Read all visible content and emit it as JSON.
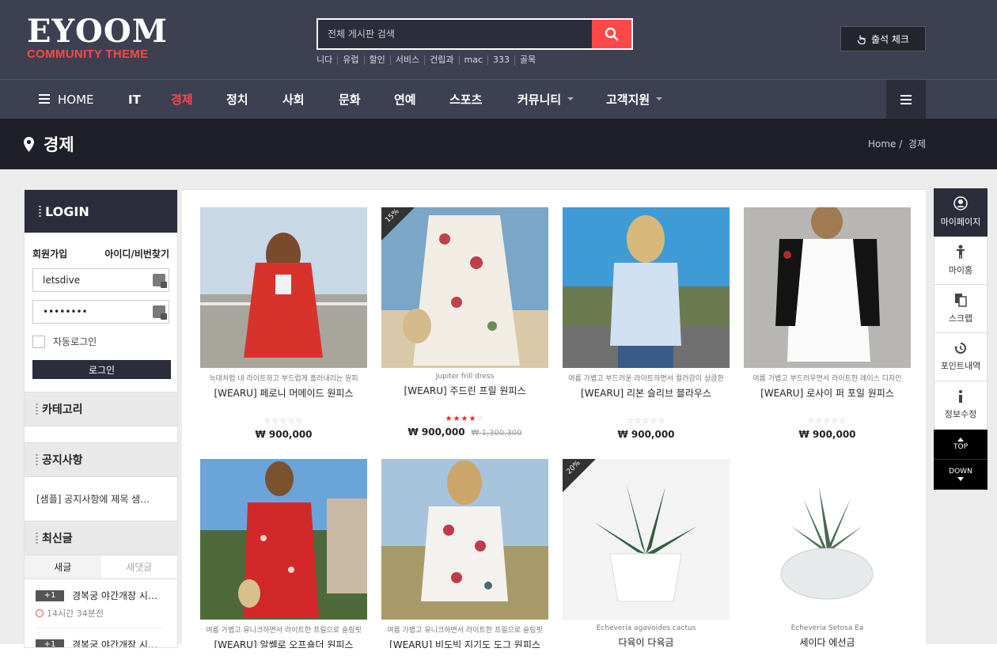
{
  "logo": {
    "main": "EYOOM",
    "sub": "COMMUNITY THEME"
  },
  "search": {
    "placeholder": "전체 게시판 검색"
  },
  "keywords": [
    "니다",
    "유럽",
    "할인",
    "서비스",
    "건립과",
    "mac",
    "333",
    "골목"
  ],
  "attend_label": "출석 체크",
  "nav": [
    {
      "label": "HOME"
    },
    {
      "label": "IT"
    },
    {
      "label": "경제"
    },
    {
      "label": "정치"
    },
    {
      "label": "사회"
    },
    {
      "label": "문화"
    },
    {
      "label": "연예"
    },
    {
      "label": "스포츠"
    },
    {
      "label": "커뮤니티"
    },
    {
      "label": "고객지원"
    }
  ],
  "page": {
    "title": "경제",
    "breadcrumb_home": "Home",
    "breadcrumb_current": "경제"
  },
  "sidebar": {
    "login_title": "LOGIN",
    "join": "회원가입",
    "find": "아이디/비번찾기",
    "username": "letsdive",
    "password": "••••••••",
    "auto_login": "자동로그인",
    "login_btn": "로그인",
    "category_title": "카테고리",
    "notice_title": "공지사항",
    "notice_item": "[샘플] 공지사항에 제목 샘…",
    "latest_title": "최신글",
    "tab_new_post": "새글",
    "tab_new_comment": "새댓글",
    "latest": [
      {
        "badge": "+1",
        "title": "경복궁 야간개장 시…",
        "time": "14시간 34분전"
      },
      {
        "badge": "+1",
        "title": "경복궁 야간개장 시…",
        "time": ""
      }
    ]
  },
  "products": [
    {
      "desc": "늑대처럼 내 라이트하고 부드럽게 흘러내리는 원피",
      "name": "[WEARU] 페로니 머메이드 원피스",
      "price": "₩ 900,000",
      "old_price": "",
      "rating": 0,
      "sale": "",
      "img": "p1"
    },
    {
      "desc": "Jupiter frill dress",
      "name": "[WEARU] 주드린 프릴 원피스",
      "price": "₩ 900,000",
      "old_price": "₩ 1,300,300",
      "rating": 4,
      "sale": "15%",
      "img": "p2"
    },
    {
      "desc": "여름 가볍고 부드러운 라이트하면서 컬러감이 상큼한",
      "name": "[WEARU] 리본 슬리브 블라우스",
      "price": "₩ 900,000",
      "old_price": "",
      "rating": 0,
      "sale": "",
      "img": "p3"
    },
    {
      "desc": "여름 가볍고 부드러우면서 라이트한 레이스 디자인",
      "name": "[WEARU] 로사이 퍼 포일 원피스",
      "price": "₩ 900,000",
      "old_price": "",
      "rating": 0,
      "sale": "",
      "img": "p4"
    },
    {
      "desc": "여름 가볍고 유니크하면서 라이트한 프릴으로 슬림핏",
      "name": "[WEARU] 알쎌로 오프숄더 원피스",
      "price": "",
      "old_price": "",
      "rating": 0,
      "sale": "",
      "img": "p5"
    },
    {
      "desc": "여름 가볍고 유니크하면서 라이트한 프릴으로 슬림핏",
      "name": "[WEARU] 비도빅 지기도 도그 원피스",
      "price": "",
      "old_price": "",
      "rating": 0,
      "sale": "",
      "img": "p6"
    },
    {
      "desc": "Echeveria agavoides cactus",
      "name": "다육이 다육금",
      "price": "",
      "old_price": "",
      "rating": 0,
      "sale": "20%",
      "img": "p7"
    },
    {
      "desc": "Echeveria Setosa Ea",
      "name": "세이다 에선금",
      "price": "",
      "old_price": "",
      "rating": 0,
      "sale": "",
      "img": "p8"
    }
  ],
  "quick": [
    {
      "label": "마이페이지",
      "icon": "user-icon"
    },
    {
      "label": "마이홈",
      "icon": "person-icon"
    },
    {
      "label": "스크랩",
      "icon": "copy-icon"
    },
    {
      "label": "포인트내역",
      "icon": "history-icon"
    },
    {
      "label": "정보수정",
      "icon": "info-icon"
    }
  ],
  "scroll": {
    "top": "TOP",
    "down": "DOWN"
  },
  "colors": {
    "header": "#3d4051",
    "accent": "#ff4848",
    "dark": "#1e1f28"
  }
}
